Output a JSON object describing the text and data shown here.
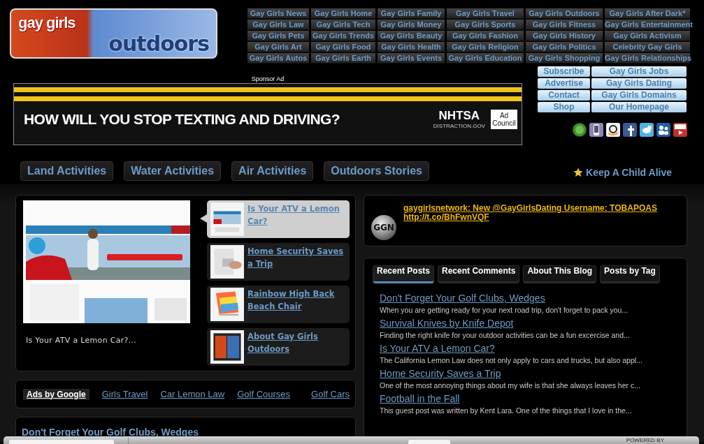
{
  "logo": {
    "line_1": "gay girls",
    "line_2": "outdoors"
  },
  "nav_links": [
    "Gay Girls News",
    "Gay Girls Home",
    "Gay Girls Family",
    "Gay Girls Travel",
    "Gay Girls Outdoors",
    "Gay Girls After Dark*",
    "Gay Girls Law",
    "Gay Girls Tech",
    "Gay Girls Money",
    "Gay Girls Sports",
    "Gay Girls Fitness",
    "Gay Girls Entertainment",
    "Gay Girls Pets",
    "Gay Girls Trends",
    "Gay Girls Beauty",
    "Gay Girls Fashion",
    "Gay Girls History",
    "Gay Girls Activism",
    "Gay Girls Art",
    "Gay Girls Food",
    "Gay Girls Health",
    "Gay Girls Religion",
    "Gay Girls Politics",
    "Celebrity Gay Girls",
    "Gay Girls Autos",
    "Gay Girls Earth",
    "Gay Girls Events",
    "Gay Girls Education",
    "Gay Girls Shopping",
    "Gay Girls Relationships"
  ],
  "sponsor": {
    "label": "Sponsor Ad",
    "headline": "HOW WILL YOU STOP TEXTING AND DRIVING?",
    "agency": "NHTSA",
    "agency_site": "DISTRACTION.GOV",
    "council": "Ad Council"
  },
  "side_links": [
    "Subscribe",
    "Gay Girls Jobs",
    "Advertise",
    "Gay Girls Dating",
    "Contact",
    "Gay Girls Domains",
    "Shop",
    "Our Homepage"
  ],
  "category_tabs": [
    "Land Activities",
    "Water Activities",
    "Air Activities",
    "Outdoors Stories"
  ],
  "featured_link": "Keep A Child Alive",
  "slideshow": {
    "caption": "Is Your ATV a Lemon Car?...",
    "items": [
      {
        "title": "Is Your ATV a Lemon Car?",
        "selected": true
      },
      {
        "title": "Home Security Saves a Trip",
        "selected": false
      },
      {
        "title": "Rainbow High Back Beach Chair",
        "selected": false
      },
      {
        "title": "About Gay Girls Outdoors",
        "selected": false
      }
    ]
  },
  "ads": {
    "label": "Ads by Google",
    "links": [
      "Girls Travel",
      "Car Lemon Law",
      "Golf Courses",
      "Golf Cars"
    ]
  },
  "next_post": {
    "title": "Don't Forget Your Golf Clubs, Wedges"
  },
  "tweet": {
    "avatar": "GGN",
    "text": "gaygirlsnetwork: New @GayGirlsDating Username: TOBAPOAS",
    "link": "http://t.co/BhFwnVQF"
  },
  "blog_tabs": [
    {
      "label": "Recent Posts",
      "selected": true
    },
    {
      "label": "Recent Comments",
      "selected": false
    },
    {
      "label": "About This Blog",
      "selected": false
    },
    {
      "label": "Posts by Tag",
      "selected": false
    }
  ],
  "posts": [
    {
      "title": "Don't Forget Your Golf Clubs, Wedges",
      "excerpt": "When you are getting ready for your next road trip, don't forget to pack you..."
    },
    {
      "title": "Survival Knives by Knife Depot",
      "excerpt": "Finding the right knife for your outdoor activities can be a fun excercise and..."
    },
    {
      "title": "Is Your ATV a Lemon Car?",
      "excerpt": "The California Lemon Law does not only apply to cars and trucks, but also appl..."
    },
    {
      "title": "Home Security Saves a Trip",
      "excerpt": "One of the most annoying things about my wife is that she always leaves her c..."
    },
    {
      "title": "Football in the Fall",
      "excerpt": "This guest post was written by Kent Lara. One of the things that I love in the..."
    }
  ],
  "toolbar": {
    "powered_by": "POWERED BY"
  }
}
